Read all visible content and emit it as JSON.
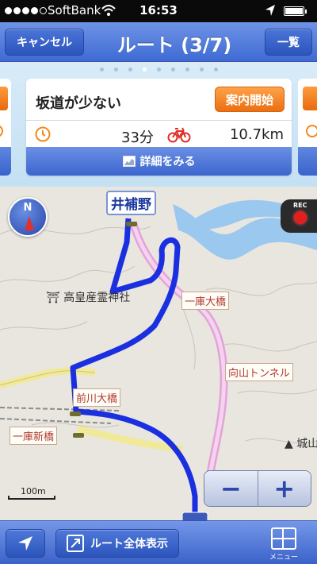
{
  "status_bar": {
    "carrier": "SoftBank",
    "time": "16:53",
    "battery_level": 1.0
  },
  "navbar": {
    "cancel_label": "キャンセル",
    "title": "ルート (3/7)",
    "list_label": "一覧"
  },
  "pager": {
    "count": 9,
    "active_index": 3
  },
  "route_card": {
    "name": "坂道が少ない",
    "start_label": "案内開始",
    "duration": "33分",
    "distance": "10.7km",
    "details_label": "詳細をみる"
  },
  "map": {
    "station_label": "井補野",
    "labels": {
      "shrine": "高皇産霊神社",
      "bridge1": "一庫大橋",
      "tunnel": "向山トンネル",
      "bridge2": "前川大橋",
      "bridge3": "一庫新橋",
      "castle": "城山"
    },
    "shrine_icon": "⛩",
    "compass_label": "N",
    "rec_label": "REC",
    "scale_label": "100m",
    "zoom_out_label": "−",
    "zoom_in_label": "+",
    "route_color": "#1a2fe0"
  },
  "toolbar": {
    "overview_label": "ルート全体表示",
    "menu_label": "メニュー"
  },
  "colors": {
    "accent_blue": "#3e6ad3",
    "start_orange": "#ea6f12",
    "river": "#9bc8ee",
    "map_bg": "#e9e6df"
  }
}
